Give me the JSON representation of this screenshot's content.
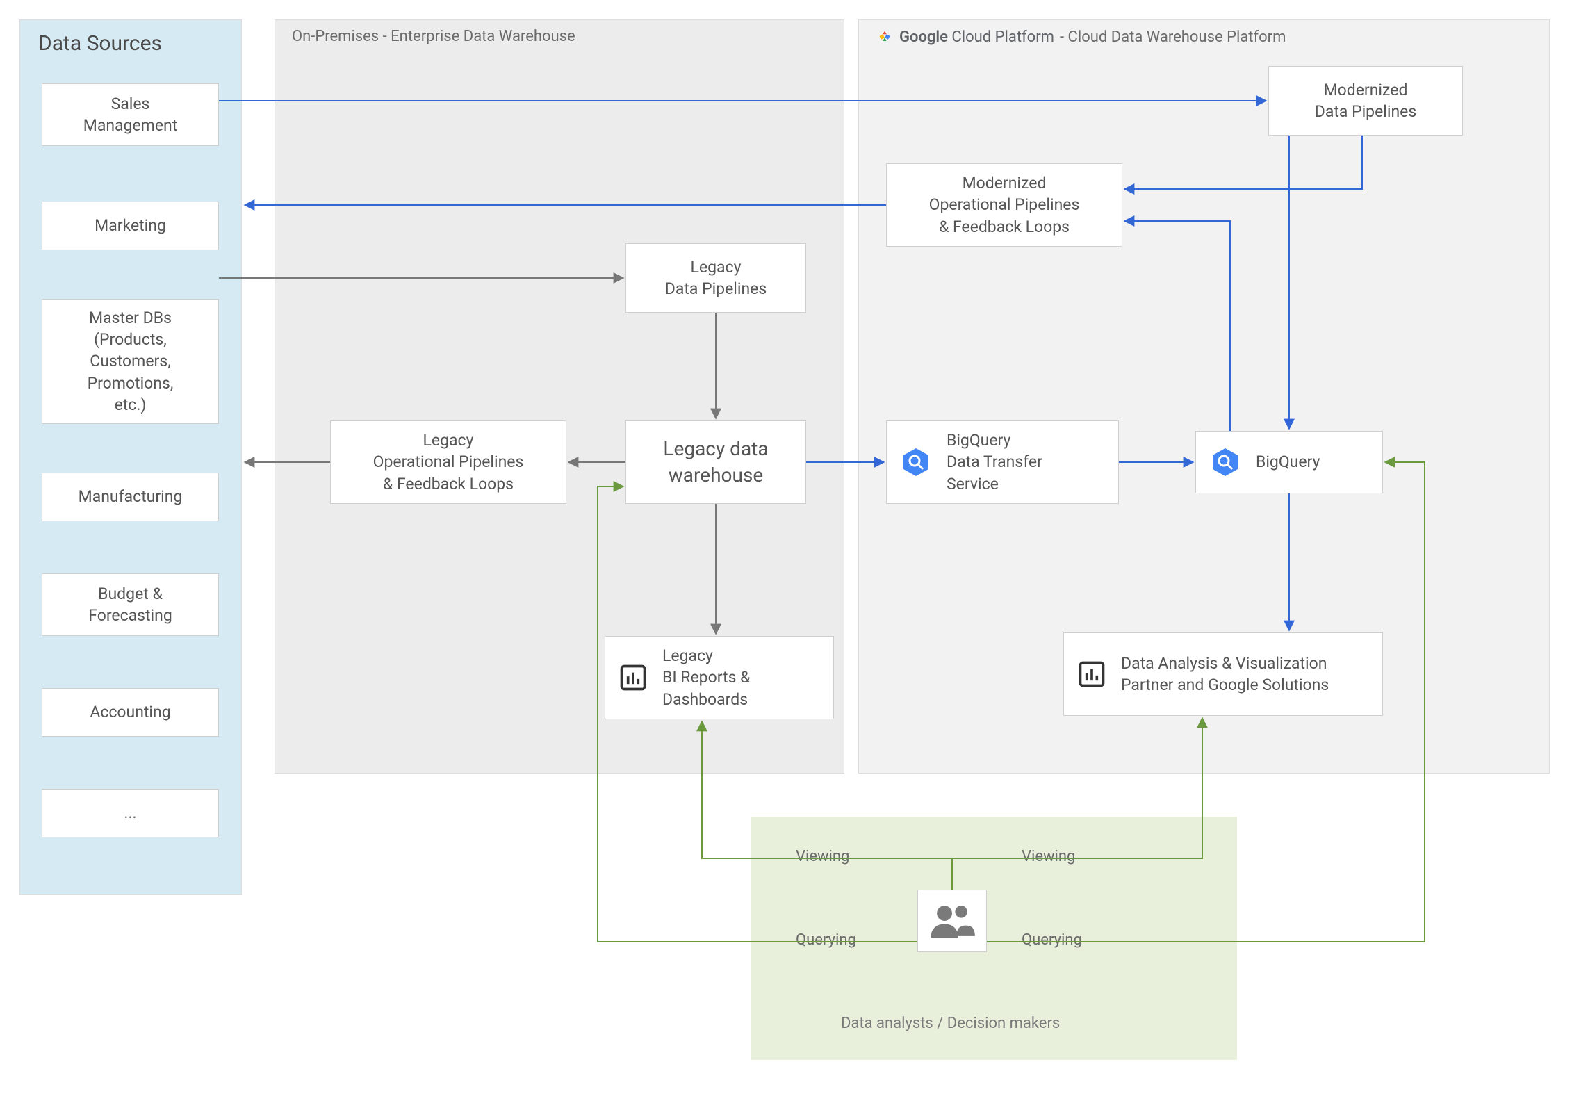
{
  "regions": {
    "sources_title": "Data Sources",
    "onprem_title": "On-Premises - Enterprise Data Warehouse",
    "gcp_title_suffix": "- Cloud Data Warehouse Platform",
    "gcp_brand_google": "Google",
    "gcp_brand_cp": " Cloud Platform "
  },
  "sources": {
    "items": [
      "Sales\nManagement",
      "Marketing",
      "Master DBs\n(Products,\nCustomers,\nPromotions,\netc.)",
      "Manufacturing",
      "Budget &\nForecasting",
      "Accounting",
      "..."
    ]
  },
  "onprem": {
    "legacy_pipelines": "Legacy\nData Pipelines",
    "legacy_ops": "Legacy\nOperational Pipelines\n& Feedback Loops",
    "legacy_dw": "Legacy data\nwarehouse",
    "legacy_bi": "Legacy\nBI Reports &\nDashboards"
  },
  "gcp": {
    "modern_pipelines": "Modernized\nData Pipelines",
    "modern_ops": "Modernized\nOperational Pipelines\n& Feedback Loops",
    "bq_dts": "BigQuery\nData Transfer\nService",
    "bigquery": "BigQuery",
    "viz": "Data Analysis & Visualization\nPartner and Google Solutions"
  },
  "analysts": {
    "viewing": "Viewing",
    "querying": "Querying",
    "caption": "Data analysts / Decision makers"
  },
  "colors": {
    "gray": "#777777",
    "blue": "#3367d6",
    "green": "#6a9a3d"
  }
}
